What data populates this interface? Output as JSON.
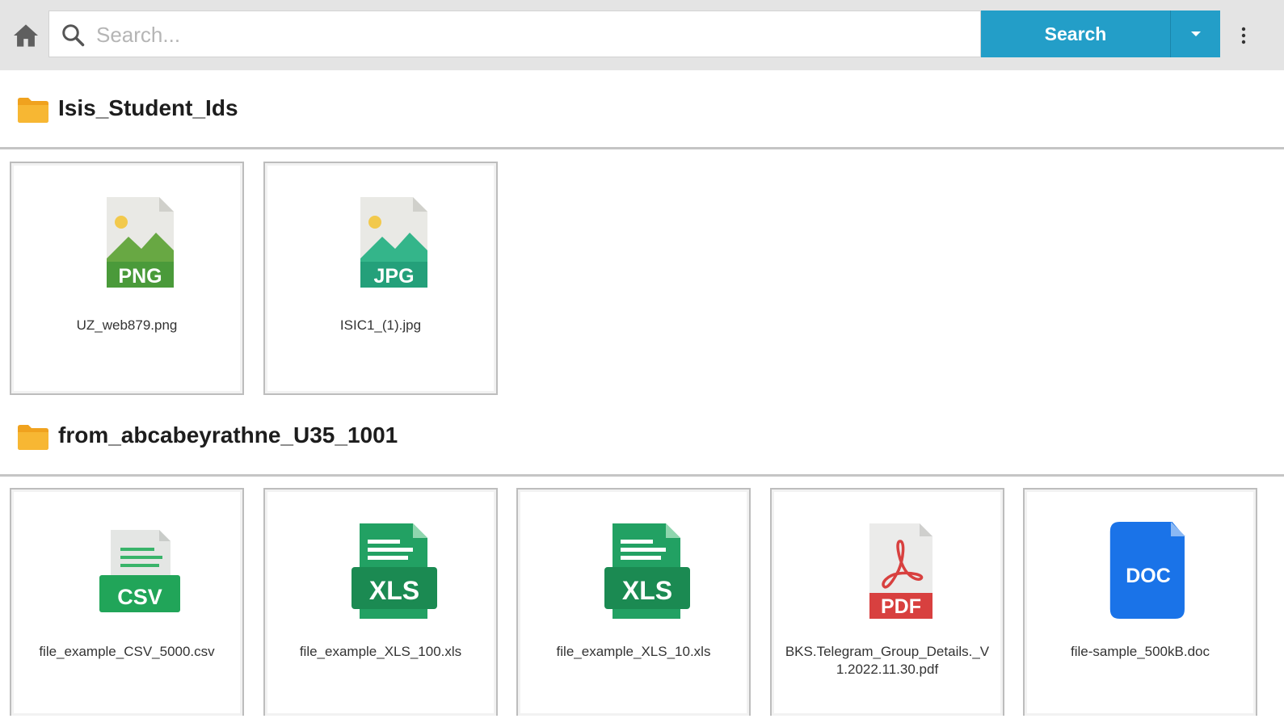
{
  "toolbar": {
    "search_placeholder": "Search...",
    "search_value": "",
    "search_button_label": "Search"
  },
  "folders": [
    {
      "name": "Isis_Student_Ids",
      "files": [
        {
          "name": "UZ_web879.png",
          "type": "PNG"
        },
        {
          "name": "ISIC1_(1).jpg",
          "type": "JPG"
        }
      ]
    },
    {
      "name": "from_abcabeyrathne_U35_1001",
      "files": [
        {
          "name": "file_example_CSV_5000.csv",
          "type": "CSV"
        },
        {
          "name": "file_example_XLS_100.xls",
          "type": "XLS"
        },
        {
          "name": "file_example_XLS_10.xls",
          "type": "XLS"
        },
        {
          "name": "BKS.Telegram_Group_Details._V1.2022.11.30.pdf",
          "type": "PDF"
        },
        {
          "name": "file-sample_500kB.doc",
          "type": "DOC"
        }
      ]
    }
  ],
  "colors": {
    "accent": "#239ec8",
    "folder": "#f5a623",
    "png": "#4a9a3a",
    "jpg": "#24a07a",
    "csv": "#21a559",
    "xls": "#22a163",
    "pdf": "#d8403f",
    "doc": "#1a73e8"
  },
  "icons": {
    "home": "home-icon",
    "search": "search-icon",
    "dropdown": "caret-down-icon",
    "more": "more-vert-icon",
    "folder": "folder-icon"
  }
}
